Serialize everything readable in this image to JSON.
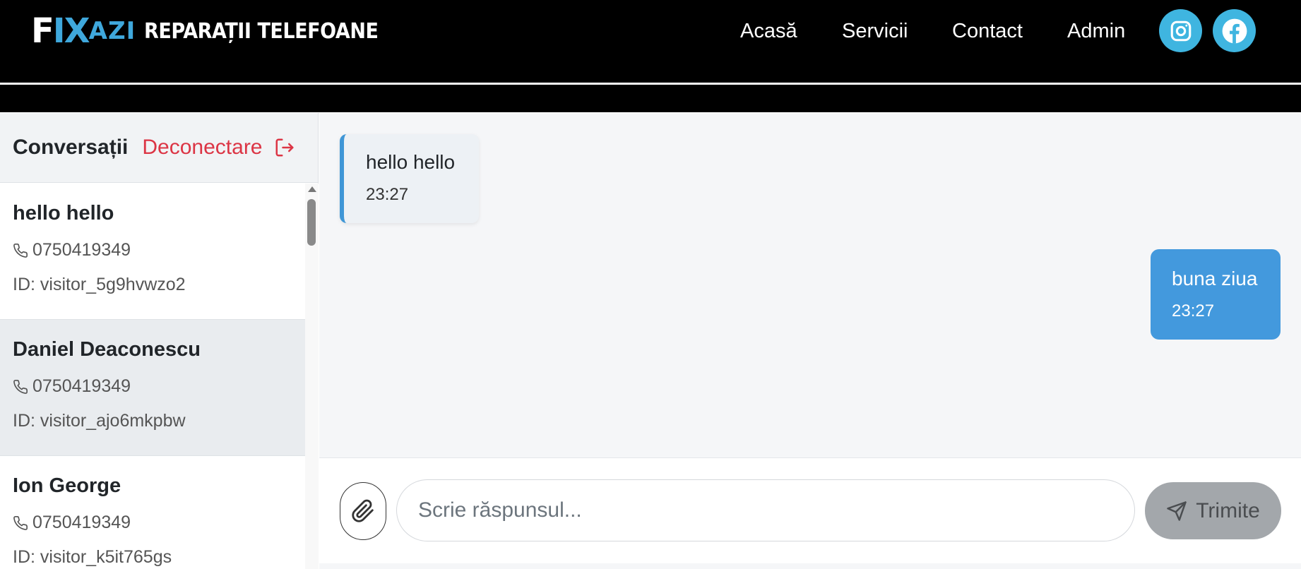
{
  "header": {
    "logo_mark_f": "F",
    "logo_mark_ix": "IX",
    "logo_mark_zi": "AZI",
    "logo_text": "REPARAȚII TELEFOANE",
    "nav": [
      "Acasă",
      "Servicii",
      "Contact",
      "Admin"
    ],
    "social": [
      "instagram-icon",
      "facebook-icon"
    ],
    "accent": "#3fb5e0"
  },
  "sidebar": {
    "title": "Conversații",
    "logout_label": "Deconectare",
    "conversations": [
      {
        "name": "hello hello",
        "phone": "0750419349",
        "id": "ID: visitor_5g9hvwzo2",
        "active": false
      },
      {
        "name": "Daniel Deaconescu",
        "phone": "0750419349",
        "id": "ID: visitor_ajo6mkpbw",
        "active": true
      },
      {
        "name": "Ion George",
        "phone": "0750419349",
        "id": "ID: visitor_k5it765gs",
        "active": false
      }
    ]
  },
  "chat": {
    "messages": [
      {
        "text": "hello hello",
        "time": "23:27",
        "direction": "incoming"
      },
      {
        "text": "buna ziua",
        "time": "23:27",
        "direction": "outgoing"
      }
    ]
  },
  "composer": {
    "placeholder": "Scrie răspunsul...",
    "value": "",
    "send_label": "Trimite"
  },
  "colors": {
    "logout": "#dc3545",
    "outgoing_bubble": "#4399dd",
    "incoming_border": "#3f96d6",
    "send_disabled": "#a3a7ab"
  }
}
